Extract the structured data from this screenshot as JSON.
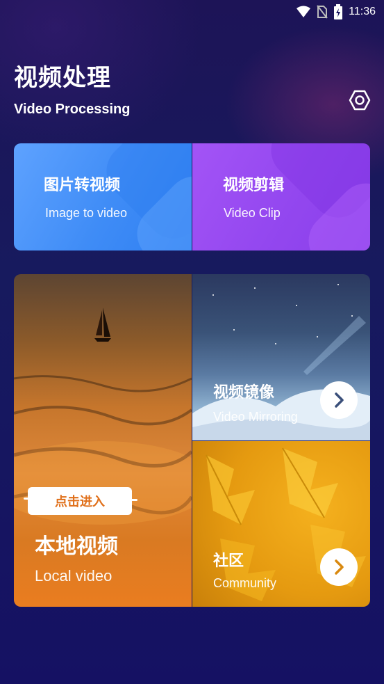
{
  "status_bar": {
    "time": "11:36",
    "icons": [
      "wifi-icon",
      "no-sim-icon",
      "battery-charging-icon"
    ]
  },
  "header": {
    "title_zh": "视频处理",
    "title_en": "Video Processing",
    "settings_icon": "settings-icon"
  },
  "cards": {
    "image_to_video": {
      "title_zh": "图片转视频",
      "title_en": "Image to video",
      "color": "#4b93f8"
    },
    "video_clip": {
      "title_zh": "视频剪辑",
      "title_en": "Video Clip",
      "color": "#9a4cf2"
    },
    "local_video": {
      "button": "点击进入",
      "title_zh": "本地视频",
      "title_en": "Local video"
    },
    "video_mirroring": {
      "title_zh": "视频镜像",
      "title_en": "Video Mirroring",
      "arrow_icon": "chevron-right-icon"
    },
    "community": {
      "title_zh": "社区",
      "title_en": "Community",
      "arrow_icon": "chevron-right-icon"
    }
  },
  "colors": {
    "background": "#181460",
    "accent_orange": "#e0701b"
  }
}
